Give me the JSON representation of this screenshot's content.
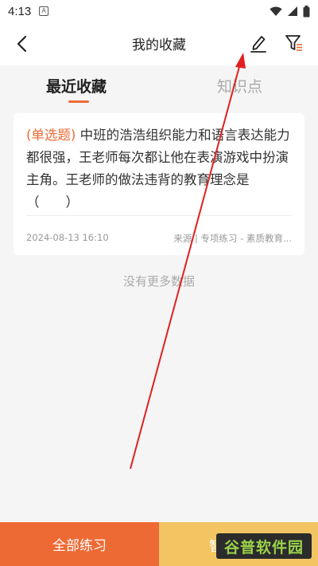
{
  "status_bar": {
    "time": "4:13",
    "app_badge": "A"
  },
  "app_bar": {
    "title": "我的收藏"
  },
  "tabs": [
    {
      "label": "最近收藏",
      "active": true
    },
    {
      "label": "知识点",
      "active": false
    }
  ],
  "card": {
    "type_label": "(单选题)",
    "question": " 中班的浩浩组织能力和语言表达能力都很强，王老师每次都让他在表演游戏中扮演主角。王老师的做法违背的教育理念是（　　）",
    "date": "2024-08-13  16:10",
    "source": "来源 | 专项练习 - 素质教育..."
  },
  "list_footer": "没有更多数据",
  "bottom_bar": {
    "practice_all": "全部练习",
    "second_button_visible": "智"
  },
  "watermark": "谷普软件园",
  "colors": {
    "accent": "#ee6a35",
    "secondary": "#f2c462",
    "annotation_arrow": "#e02020"
  }
}
